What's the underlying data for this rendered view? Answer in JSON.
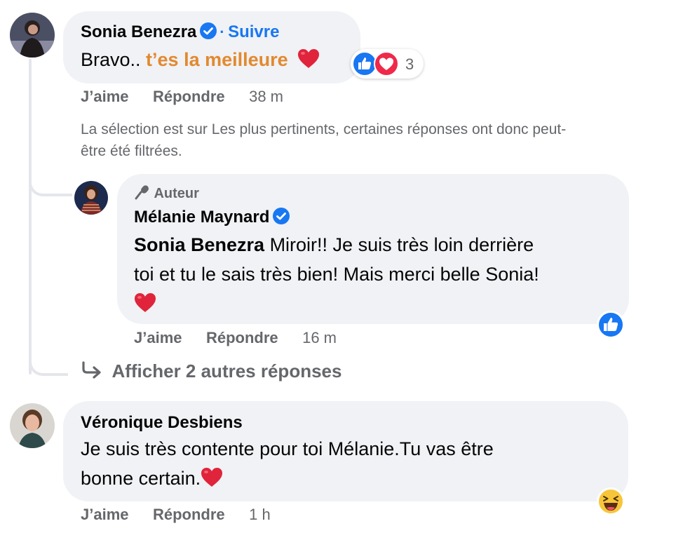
{
  "comment1": {
    "author": "Sonia Benezra",
    "follow_sep": "·",
    "follow": "Suivre",
    "text_plain": "Bravo.. ",
    "text_highlight": "t’es la meilleure",
    "reaction_count": "3",
    "like": "J’aime",
    "reply": "Répondre",
    "time": "38 m"
  },
  "filter_notice": {
    "line1": "La sélection est sur Les plus pertinents, certaines réponses ont donc peut-",
    "line2": "être été filtrées."
  },
  "reply1": {
    "badge": "Auteur",
    "author": "Mélanie Maynard",
    "mention": "Sonia Benezra",
    "line1": " Miroir!! Je suis très loin derrière",
    "line2": "toi et tu le sais très bien! Mais merci belle Sonia!",
    "like": "J’aime",
    "reply": "Répondre",
    "time": "16 m"
  },
  "more_replies": "Afficher 2 autres réponses",
  "comment2": {
    "author": "Véronique Desbiens",
    "line1": "Je suis très contente pour toi Mélanie.Tu vas être",
    "line2": "bonne certain.",
    "like": "J’aime",
    "reply": "Répondre",
    "time": "1 h"
  },
  "colors": {
    "facebook_blue": "#1877f2",
    "highlight_orange": "#e2892f",
    "love_red": "#f0284a",
    "bubble_bg": "#f0f2f5",
    "secondary_text": "#65676b"
  },
  "icons": [
    "verified-badge-icon",
    "like-reaction-icon",
    "love-reaction-icon",
    "heart-emoji-icon",
    "microphone-icon",
    "reply-arrow-icon",
    "haha-reaction-icon"
  ]
}
